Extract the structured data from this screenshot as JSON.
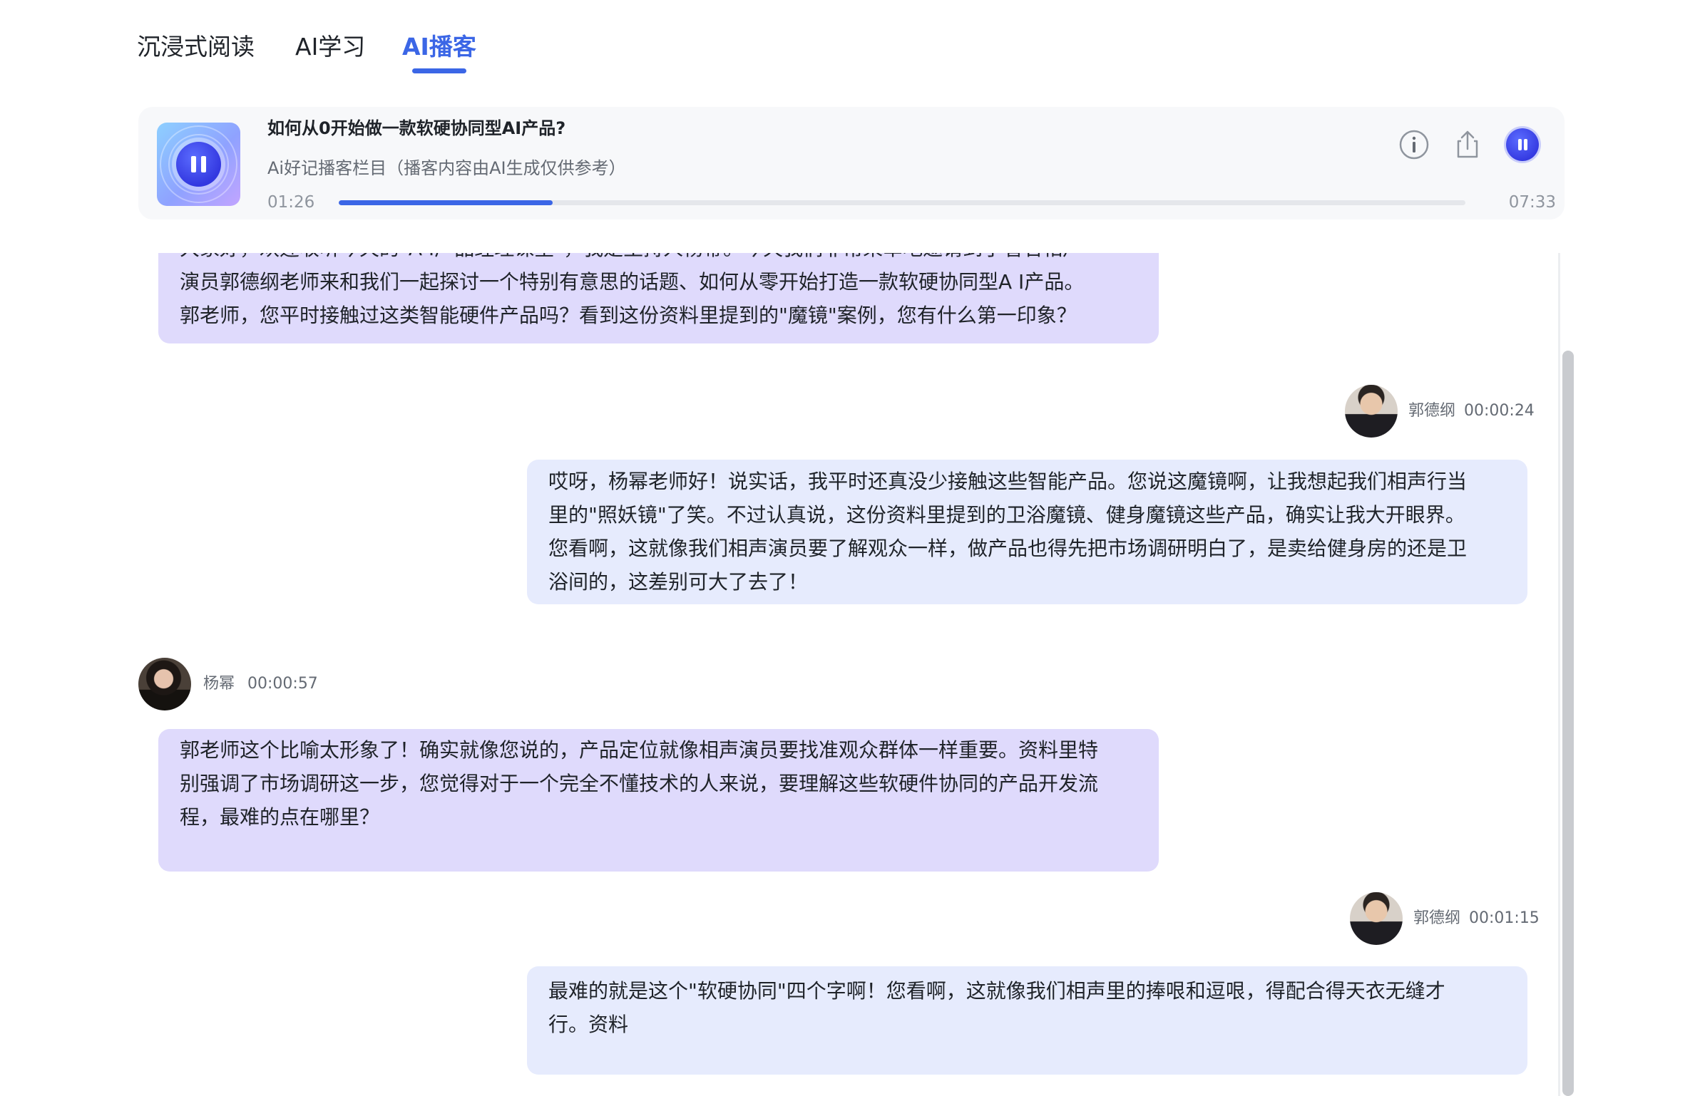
{
  "tabs": [
    {
      "label": "沉浸式阅读",
      "active": false
    },
    {
      "label": "AI学习",
      "active": false
    },
    {
      "label": "AI播客",
      "active": true
    }
  ],
  "player": {
    "title": "如何从0开始做一款软硬协同型AI产品?",
    "subtitle": "Ai好记播客栏目（播客内容由AI生成仅供参考）",
    "current_time": "01:26",
    "total_time": "07:33",
    "progress": 0.19,
    "state": "playing",
    "icons": [
      "pause-icon",
      "info-icon",
      "share-icon",
      "pause-icon"
    ]
  },
  "transcript": [
    {
      "role": "host",
      "lines": [
        "大家好，欢迎收听今天的\"A I产品经理课堂\"，我是主持人杨幂。今天我们非常荣幸地邀请到了著名相声",
        "演员郭德纲老师来和我们一起探讨一个特别有意思的话题、如何从零开始打造一款软硬协同型A I产品。",
        "郭老师，您平时接触过这类智能硬件产品吗？看到这份资料里提到的\"魔镜\"案例，您有什么第一印象？"
      ]
    },
    {
      "role": "guest",
      "speaker": "郭德纲",
      "time": "00:00:24",
      "lines": [
        "哎呀，杨幂老师好！说实话，我平时还真没少接触这些智能产品。您说这魔镜啊，让我想起我们相声行当",
        "里的\"照妖镜\"了笑。不过认真说，这份资料里提到的卫浴魔镜、健身魔镜这些产品，确实让我大开眼界。",
        "您看啊，这就像我们相声演员要了解观众一样，做产品也得先把市场调研明白了，是卖给健身房的还是卫",
        "浴间的，这差别可大了去了！"
      ]
    },
    {
      "role": "host",
      "speaker": "杨幂",
      "time": "00:00:57",
      "lines": [
        "郭老师这个比喻太形象了！确实就像您说的，产品定位就像相声演员要找准观众群体一样重要。资料里特",
        "别强调了市场调研这一步，您觉得对于一个完全不懂技术的人来说，要理解这些软硬件协同的产品开发流",
        "程，最难的点在哪里？"
      ]
    },
    {
      "role": "guest",
      "speaker": "郭德纲",
      "time": "00:01:15",
      "lines": [
        "最难的就是这个\"软硬协同\"四个字啊！您看啊，这就像我们相声里的捧哏和逗哏，得配合得天衣无缝才",
        "行。资料"
      ]
    }
  ]
}
